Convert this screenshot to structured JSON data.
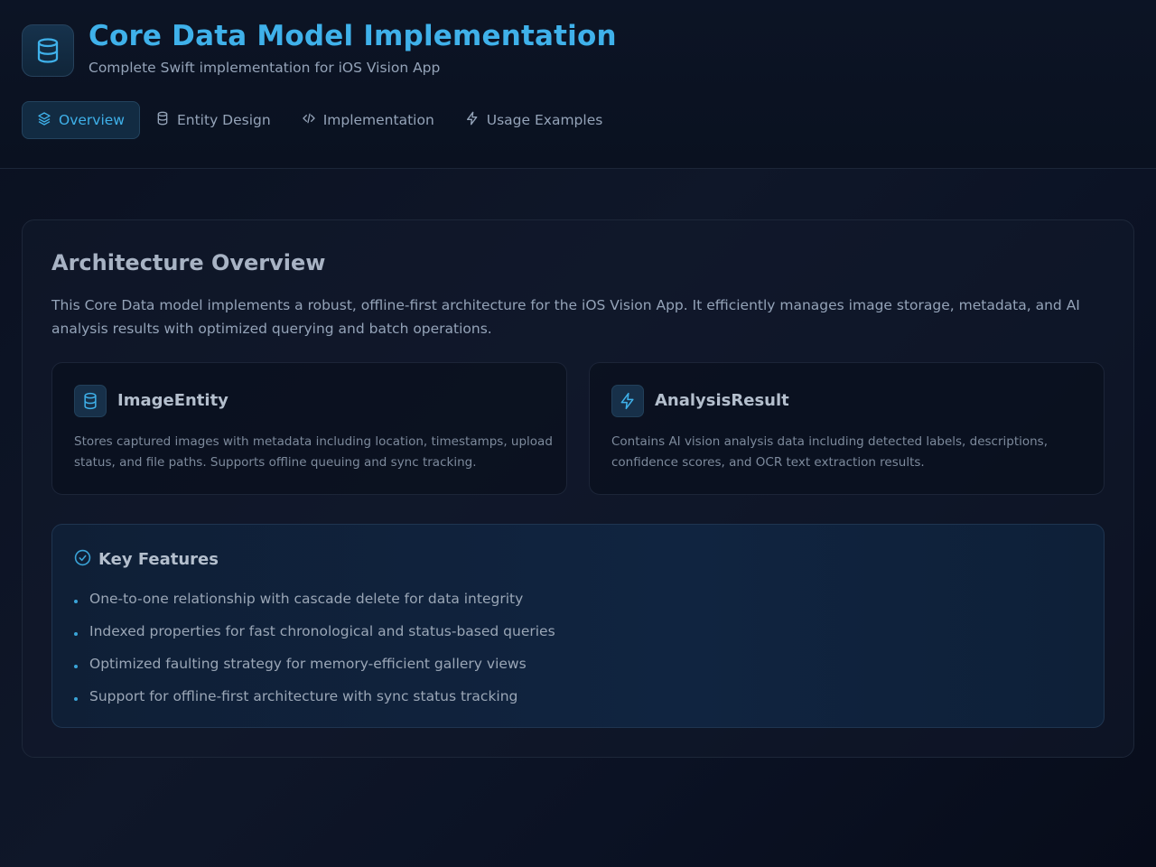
{
  "header": {
    "title": "Core Data Model Implementation",
    "subtitle": "Complete Swift implementation for iOS Vision App",
    "logo_icon": "database-icon"
  },
  "tabs": [
    {
      "label": "Overview",
      "icon": "layers-icon",
      "active": true
    },
    {
      "label": "Entity Design",
      "icon": "database-icon",
      "active": false
    },
    {
      "label": "Implementation",
      "icon": "code-icon",
      "active": false
    },
    {
      "label": "Usage Examples",
      "icon": "lightning-icon",
      "active": false
    }
  ],
  "overview": {
    "title": "Architecture Overview",
    "description": "This Core Data model implements a robust, offline-first architecture for the iOS Vision App. It efficiently manages image storage, metadata, and AI analysis results with optimized querying and batch operations.",
    "cards": [
      {
        "title": "ImageEntity",
        "icon": "database-icon",
        "description": "Stores captured images with metadata including location, timestamps, upload status, and file paths. Supports offline queuing and sync tracking."
      },
      {
        "title": "AnalysisResult",
        "icon": "lightning-icon",
        "description": "Contains AI vision analysis data including detected labels, descriptions, confidence scores, and OCR text extraction results."
      }
    ],
    "features": {
      "title": "Key Features",
      "icon": "check-circle-icon",
      "items": [
        "One-to-one relationship with cascade delete for data integrity",
        "Indexed properties for fast chronological and status-based queries",
        "Optimized faulting strategy for memory-efficient gallery views",
        "Support for offline-first architecture with sync status tracking"
      ]
    }
  },
  "colors": {
    "accent": "#3fb1ea",
    "background": "#0f1729",
    "text_muted": "#94a3b8"
  }
}
